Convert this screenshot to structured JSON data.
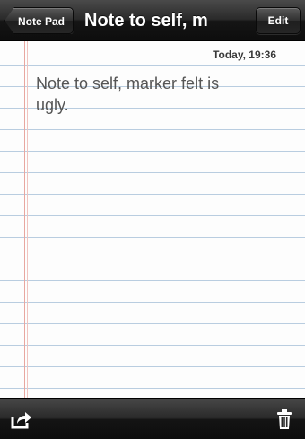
{
  "navbar": {
    "back_label": "Note Pad",
    "title": "Note to self, m",
    "edit_label": "Edit"
  },
  "note": {
    "timestamp": "Today, 19:36",
    "body": "Note to self, marker felt is\nugly."
  },
  "toolbar": {
    "share_icon": "share-icon",
    "trash_icon": "trash-icon"
  },
  "colors": {
    "margin_line": "#e8a7a0",
    "rule_line": "#b9cde0",
    "bar": "#1e1e1e"
  }
}
